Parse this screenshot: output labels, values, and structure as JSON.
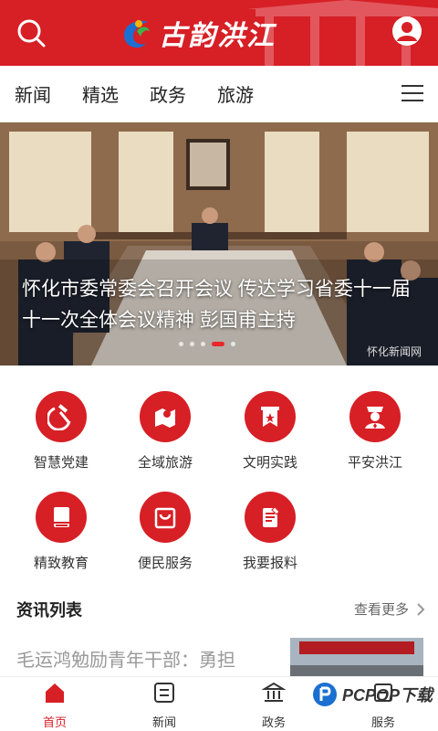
{
  "header": {
    "app_title": "古韵洪江",
    "search_icon": "search-icon",
    "user_icon": "user-icon"
  },
  "tabs": [
    {
      "label": "新闻"
    },
    {
      "label": "精选"
    },
    {
      "label": "政务"
    },
    {
      "label": "旅游"
    }
  ],
  "banner": {
    "caption": "怀化市委常委会召开会议 传达学习省委十一届十一次全体会议精神 彭国甫主持",
    "watermark": "怀化新闻网",
    "slide_count": 5,
    "active_slide": 4
  },
  "services": [
    {
      "label": "智慧党建",
      "icon": "hammer-sickle-icon"
    },
    {
      "label": "全域旅游",
      "icon": "map-pin-icon"
    },
    {
      "label": "文明实践",
      "icon": "banner-star-icon"
    },
    {
      "label": "平安洪江",
      "icon": "police-badge-icon"
    },
    {
      "label": "精致教育",
      "icon": "book-icon"
    },
    {
      "label": "便民服务",
      "icon": "shopping-bag-icon"
    },
    {
      "label": "我要报料",
      "icon": "report-clipboard-icon"
    }
  ],
  "news_section": {
    "title": "资讯列表",
    "more_label": "查看更多",
    "items": [
      {
        "title": "毛运鸿勉励青年干部：勇担"
      }
    ]
  },
  "bottom_nav": [
    {
      "label": "首页",
      "active": true
    },
    {
      "label": "新闻",
      "active": false
    },
    {
      "label": "政务",
      "active": false
    },
    {
      "label": "服务",
      "active": false
    }
  ],
  "overlay_watermark": {
    "text": "PCPOP下载"
  },
  "colors": {
    "brand_red": "#d71f26"
  }
}
